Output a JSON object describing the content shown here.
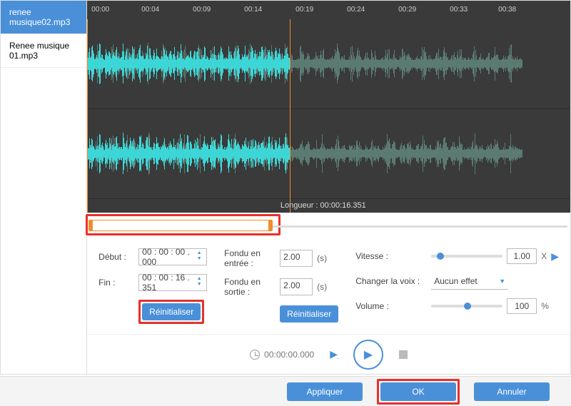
{
  "sidebar": {
    "files": [
      {
        "name": "renee musique02.mp3",
        "active": true
      },
      {
        "name": "Renee musique 01.mp3",
        "active": false
      }
    ]
  },
  "timeline": {
    "ticks": [
      "00:00",
      "00:04",
      "00:09",
      "00:14",
      "00:19",
      "00:24",
      "00:29",
      "00:33",
      "00:38"
    ],
    "length_label": "Longueur : 00:00:16.351"
  },
  "controls": {
    "debut_label": "Début :",
    "debut_value": "00 : 00 : 00 . 000",
    "fin_label": "Fin :",
    "fin_value": "00 : 00 : 16 . 351",
    "reset_label": "Réinitialiser",
    "fadein_label": "Fondu en entrée :",
    "fadein_value": "2.00",
    "fadeout_label": "Fondu en sortie :",
    "fadeout_value": "2.00",
    "seconds_unit": "(s)",
    "fade_reset_label": "Réinitialiser",
    "speed_label": "Vitesse :",
    "speed_value": "1.00",
    "speed_unit": "X",
    "voice_label": "Changer la voix :",
    "voice_value": "Aucun effet",
    "volume_label": "Volume :",
    "volume_value": "100",
    "volume_unit": "%"
  },
  "playback": {
    "time": "00:00:00.000"
  },
  "footer": {
    "apply": "Appliquer",
    "ok": "OK",
    "cancel": "Annuler"
  },
  "colors": {
    "primary": "#4a90d9",
    "highlight": "#e8302a",
    "waveform_active": "#3dd6d6",
    "waveform_inactive": "#5a7a72",
    "cursor": "#f28c28"
  }
}
